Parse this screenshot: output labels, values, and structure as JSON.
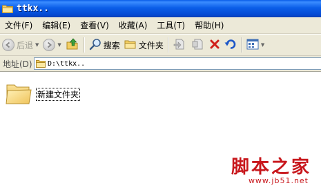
{
  "window": {
    "title": "ttkx.."
  },
  "menu": {
    "items": [
      {
        "label": "文件(F)"
      },
      {
        "label": "编辑(E)"
      },
      {
        "label": "查看(V)"
      },
      {
        "label": "收藏(A)"
      },
      {
        "label": "工具(T)"
      },
      {
        "label": "帮助(H)"
      }
    ]
  },
  "toolbar": {
    "back_label": "后退",
    "search_label": "搜索",
    "folders_label": "文件夹",
    "icons": [
      "back-arrow-icon",
      "forward-arrow-icon",
      "up-folder-icon",
      "search-icon",
      "folders-icon",
      "move-to-icon",
      "copy-to-icon",
      "delete-icon",
      "undo-icon",
      "views-icon"
    ]
  },
  "address": {
    "label": "地址(D)",
    "value": "D:\\ttkx.."
  },
  "content": {
    "items": [
      {
        "name": "新建文件夹",
        "icon": "folder-icon"
      }
    ]
  },
  "watermark": {
    "text": "脚本之家",
    "url": "www.jb51.net",
    "color": "#c8171c"
  }
}
